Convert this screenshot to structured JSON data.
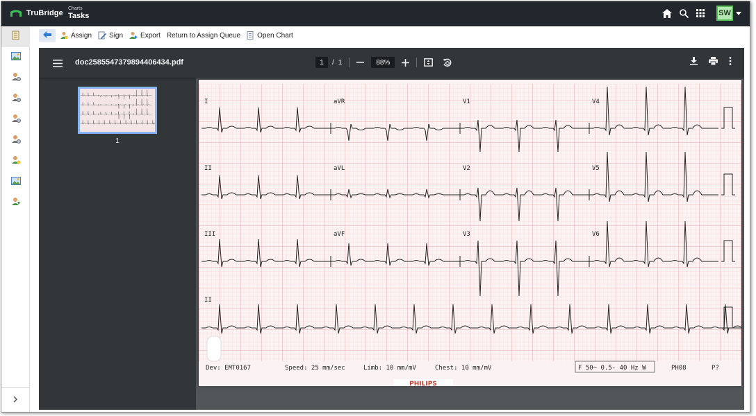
{
  "app": {
    "brand": "TruBridge",
    "crumb_small": "Charts",
    "crumb_big": "Tasks",
    "user_initials": "SW",
    "top_icons": [
      "home-icon",
      "search-icon",
      "apps-grid-icon"
    ]
  },
  "rail": {
    "items": [
      "document-icon",
      "image-icon",
      "user-gear-icon",
      "user-gear-icon",
      "user-gear-icon",
      "user-gear-icon",
      "user-add-icon",
      "image-icon",
      "user-download-icon"
    ],
    "expand_icon": "chevron-right-icon"
  },
  "toolbar": {
    "assign": "Assign",
    "sign": "Sign",
    "export": "Export",
    "return_queue": "Return to Assign Queue",
    "open_chart": "Open Chart"
  },
  "viewer": {
    "filename": "doc2585547379894406434.pdf",
    "page_current": "1",
    "page_sep": "/",
    "page_total": "1",
    "zoom": "88%",
    "thumb_label": "1"
  },
  "ecg": {
    "leads_row1": [
      "I",
      "aVR",
      "V1",
      "V4"
    ],
    "leads_row2": [
      "II",
      "aVL",
      "V2",
      "V5"
    ],
    "leads_row3": [
      "III",
      "aVF",
      "V3",
      "V6"
    ],
    "leads_row4": [
      "II"
    ],
    "footer_dev": "Dev: EMT0167",
    "footer_speed": "Speed: 25 mm/sec",
    "footer_limb": "Limb: 10 mm/mV",
    "footer_chest": "Chest: 10 mm/mV",
    "footer_filter": "F 50~ 0.5- 40 Hz W",
    "footer_code": "PH08",
    "footer_page": "P?",
    "brand_strip": "PHILIPS",
    "colors": {
      "grid_major": "#e7a3a8",
      "grid_minor": "#f6d9db",
      "trace": "#222222",
      "paper": "#fbf3f3"
    }
  }
}
